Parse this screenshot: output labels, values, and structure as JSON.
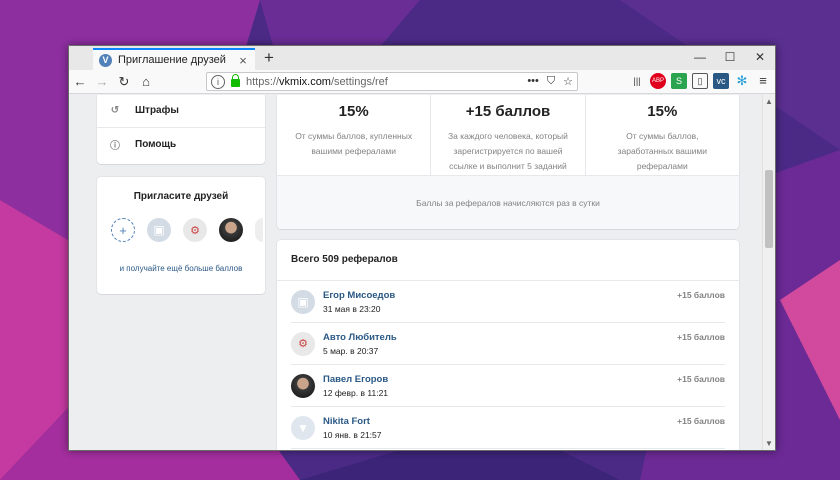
{
  "browser": {
    "tab_title": "Приглашение друзей",
    "tab_favicon_letter": "V",
    "new_tab": "+",
    "url_prefix": "https://",
    "url_domain": "vkmix.com",
    "url_path": "/settings/ref",
    "icons": [
      "back-icon",
      "forward-icon",
      "reload-icon",
      "home-icon",
      "info-icon",
      "lock-icon",
      "more-icon",
      "pocket-icon",
      "star-icon",
      "library-icon",
      "adblock-icon",
      "extension-icon",
      "sidebar-icon",
      "vk-icon",
      "settings-icon",
      "menu-icon"
    ]
  },
  "sidebar": {
    "menu": [
      {
        "label": "Штрафы",
        "icon": "penalty-icon"
      },
      {
        "label": "Помощь",
        "icon": "help-icon"
      }
    ],
    "invite": {
      "title": "Пригласите друзей",
      "link": "и получайте ещё больше баллов"
    }
  },
  "stats": [
    {
      "value": "15%",
      "desc": "От суммы баллов, купленных вашими рефералами"
    },
    {
      "value": "+15 баллов",
      "desc": "За каждого человека, который зарегистрируется по вашей ссылке и выполнит 5 заданий"
    },
    {
      "value": "15%",
      "desc": "От суммы баллов, заработанных вашими рефералами"
    }
  ],
  "stats_footer": "Баллы за рефералов начисляются раз в сутки",
  "referrals": {
    "title": "Всего 509 рефералов",
    "items": [
      {
        "name": "Егор Мисоедов",
        "date": "31 мая в 23:20",
        "points": "+15 баллов",
        "avatar": "camera-icon"
      },
      {
        "name": "Авто Любитель",
        "date": "5 мар. в 20:37",
        "points": "+15 баллов",
        "avatar": "robot-icon"
      },
      {
        "name": "Павел Егоров",
        "date": "12 февр. в 11:21",
        "points": "+15 баллов",
        "avatar": "photo"
      },
      {
        "name": "Nikita Fort",
        "date": "10 янв. в 21:57",
        "points": "+15 баллов",
        "avatar": "dog-icon"
      }
    ]
  }
}
